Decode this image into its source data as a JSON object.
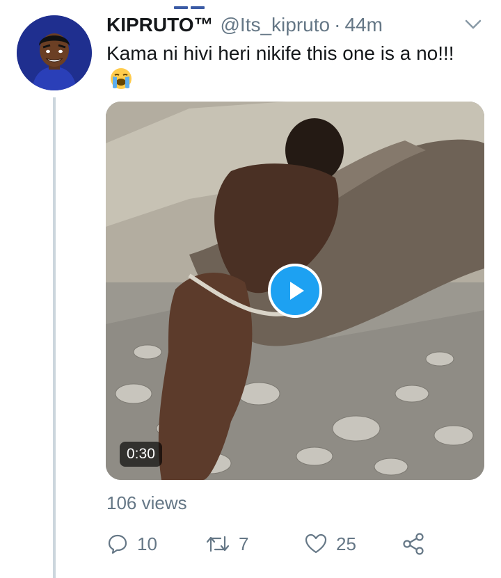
{
  "tweet": {
    "display_name": "KIPRUTO™",
    "handle": "@Its_kipruto",
    "separator": "·",
    "time": "44m",
    "text": "Kama ni hivi heri nikife this one is a no!!!",
    "emoji": "loudly-crying-face"
  },
  "media": {
    "type": "video",
    "duration": "0:30",
    "play_icon": "play-icon"
  },
  "stats": {
    "views": "106 views"
  },
  "actions": {
    "reply_count": "10",
    "retweet_count": "7",
    "like_count": "25"
  },
  "colors": {
    "accent": "#1da1f2",
    "secondary_text": "#657786",
    "thread_line": "#ccd6dd",
    "avatar_bg": "#1f2f8f"
  }
}
